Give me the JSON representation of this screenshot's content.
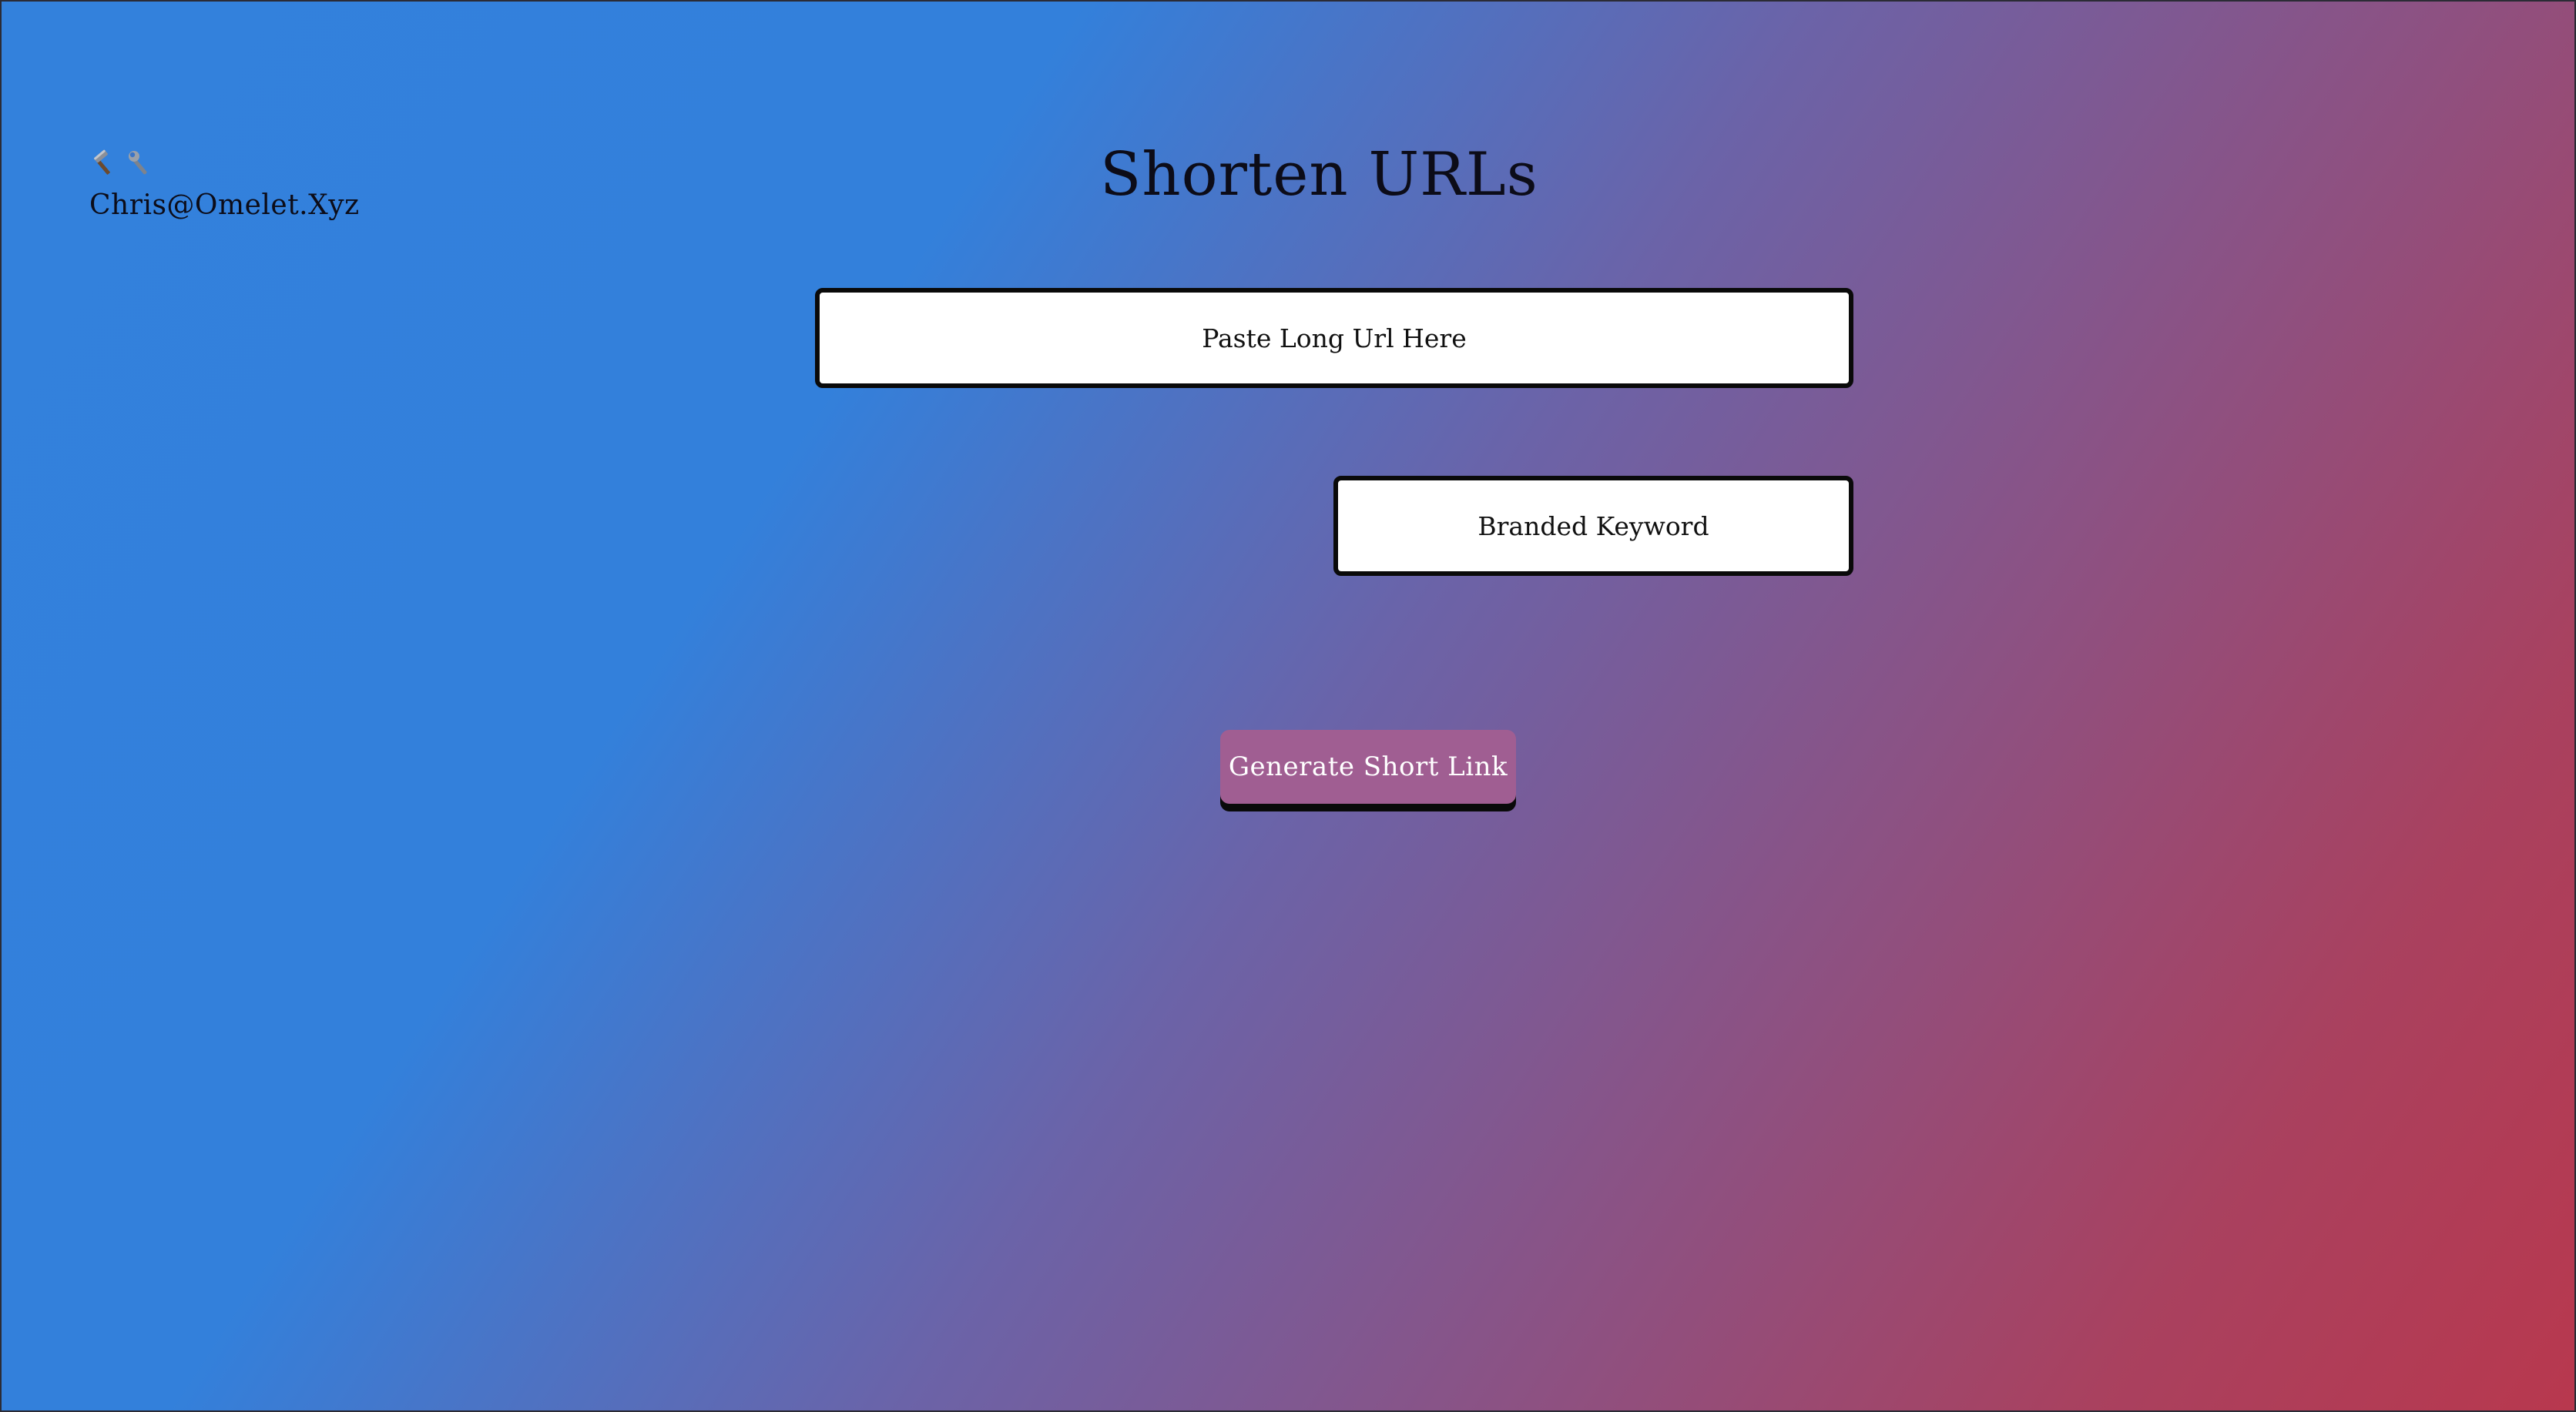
{
  "header": {
    "icons": [
      "hammer-icon",
      "wrench-icon"
    ],
    "user_email": "Chris@Omelet.Xyz"
  },
  "main": {
    "title": "Shorten URLs",
    "url_input": {
      "value": "",
      "placeholder": "Paste Long Url Here"
    },
    "keyword_input": {
      "value": "",
      "placeholder": "Branded Keyword"
    },
    "generate_button_label": "Generate Short Link"
  },
  "colors": {
    "gradient_start": "#3381dc",
    "gradient_mid": "#6b63a8",
    "gradient_end": "#b8384e",
    "button_bg": "#a05e92",
    "button_text": "#ffffff",
    "input_bg": "#ffffff",
    "input_border": "#0a0a0a"
  }
}
